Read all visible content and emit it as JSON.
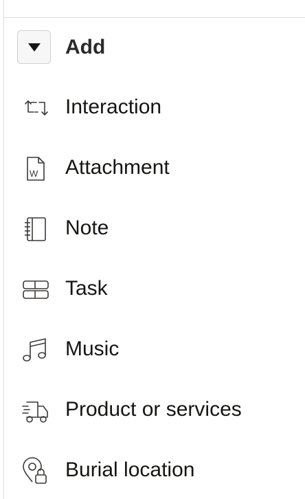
{
  "add_menu": {
    "toggle_icon": "caret-down-icon",
    "label": "Add"
  },
  "items": [
    {
      "label": "Interaction",
      "icon": "interaction-icon"
    },
    {
      "label": "Attachment",
      "icon": "word-document-icon"
    },
    {
      "label": "Note",
      "icon": "notebook-icon"
    },
    {
      "label": "Task",
      "icon": "task-icon"
    },
    {
      "label": "Music",
      "icon": "music-note-icon"
    },
    {
      "label": "Product or services",
      "icon": "delivery-truck-icon"
    },
    {
      "label": "Burial location",
      "icon": "location-lock-icon"
    }
  ]
}
